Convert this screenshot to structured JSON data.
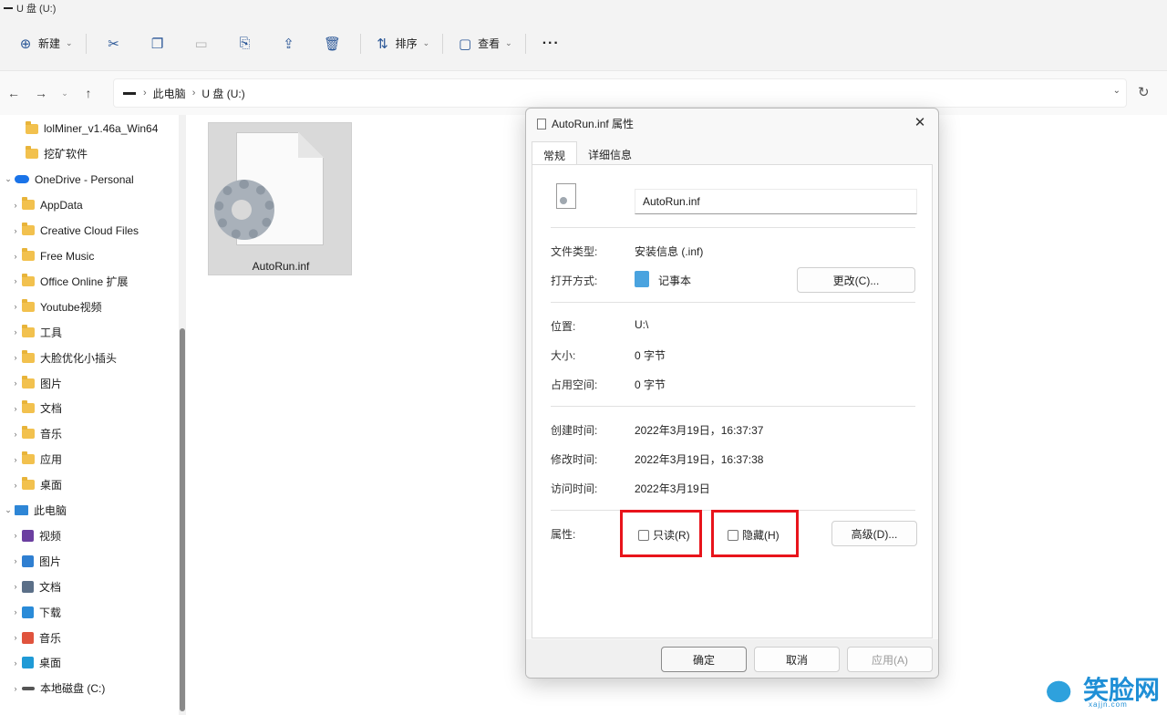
{
  "window": {
    "title": "U 盘 (U:)"
  },
  "toolbar": {
    "new_label": "新建",
    "sort_label": "排序",
    "view_label": "查看",
    "more_label": "···"
  },
  "nav": {
    "breadcrumb": [
      "此电脑",
      "U 盘 (U:)"
    ]
  },
  "sidebar": {
    "items": [
      {
        "label": "lolMiner_v1.46a_Win64",
        "icon": "folder-icon",
        "indent": 2,
        "chevron": false
      },
      {
        "label": "挖矿软件",
        "icon": "folder-icon",
        "indent": 2,
        "chevron": false
      },
      {
        "label": "OneDrive - Personal",
        "icon": "cloud-icon",
        "indent": 1,
        "chevron": true,
        "expanded": true
      },
      {
        "label": "AppData",
        "icon": "folder-icon",
        "indent": 2,
        "chevron": true
      },
      {
        "label": "Creative Cloud Files",
        "icon": "folder-icon",
        "indent": 2,
        "chevron": true
      },
      {
        "label": "Free Music",
        "icon": "folder-icon",
        "indent": 2,
        "chevron": true
      },
      {
        "label": "Office Online 扩展",
        "icon": "folder-icon",
        "indent": 2,
        "chevron": true
      },
      {
        "label": "Youtube视频",
        "icon": "folder-icon",
        "indent": 2,
        "chevron": true
      },
      {
        "label": "工具",
        "icon": "folder-icon",
        "indent": 2,
        "chevron": true
      },
      {
        "label": "大脸优化小插头",
        "icon": "folder-icon",
        "indent": 2,
        "chevron": true
      },
      {
        "label": "图片",
        "icon": "folder-icon",
        "indent": 2,
        "chevron": true
      },
      {
        "label": "文档",
        "icon": "folder-icon",
        "indent": 2,
        "chevron": true
      },
      {
        "label": "音乐",
        "icon": "folder-icon",
        "indent": 2,
        "chevron": true
      },
      {
        "label": "应用",
        "icon": "folder-icon",
        "indent": 2,
        "chevron": true
      },
      {
        "label": "桌面",
        "icon": "folder-icon",
        "indent": 2,
        "chevron": true
      },
      {
        "label": "此电脑",
        "icon": "computer-icon",
        "indent": 1,
        "chevron": true,
        "expanded": true
      },
      {
        "label": "视频",
        "icon": "video-icon",
        "indent": 2,
        "chevron": true
      },
      {
        "label": "图片",
        "icon": "pictures-icon",
        "indent": 2,
        "chevron": true
      },
      {
        "label": "文档",
        "icon": "documents-icon",
        "indent": 2,
        "chevron": true
      },
      {
        "label": "下载",
        "icon": "download-icon",
        "indent": 2,
        "chevron": true
      },
      {
        "label": "音乐",
        "icon": "music-icon",
        "indent": 2,
        "chevron": true
      },
      {
        "label": "桌面",
        "icon": "desktop-icon",
        "indent": 2,
        "chevron": true
      },
      {
        "label": "本地磁盘 (C:)",
        "icon": "drive-icon",
        "indent": 2,
        "chevron": true
      }
    ]
  },
  "files": [
    {
      "name": "AutoRun.inf",
      "selected": true
    }
  ],
  "dialog": {
    "title": "AutoRun.inf 属性",
    "tabs": [
      "常规",
      "详细信息"
    ],
    "active_tab": "常规",
    "filename": "AutoRun.inf",
    "type_label": "文件类型:",
    "type_value": "安装信息 (.inf)",
    "open_with_label": "打开方式:",
    "open_with_value": "记事本",
    "change_button": "更改(C)...",
    "location_label": "位置:",
    "location_value": "U:\\",
    "size_label": "大小:",
    "size_value": "0 字节",
    "disk_size_label": "占用空间:",
    "disk_size_value": "0 字节",
    "created_label": "创建时间:",
    "created_value": "2022年3月19日，16:37:37",
    "modified_label": "修改时间:",
    "modified_value": "2022年3月19日，16:37:38",
    "accessed_label": "访问时间:",
    "accessed_value": "2022年3月19日",
    "attributes_label": "属性:",
    "readonly_label": "只读(R)",
    "hidden_label": "隐藏(H)",
    "readonly_checked": false,
    "hidden_checked": false,
    "advanced_button": "高级(D)...",
    "ok_button": "确定",
    "cancel_button": "取消",
    "apply_button": "应用(A)"
  },
  "highlight_color": "#e8141b",
  "watermark": {
    "text": "笑脸网",
    "url": "xajjn.com"
  }
}
